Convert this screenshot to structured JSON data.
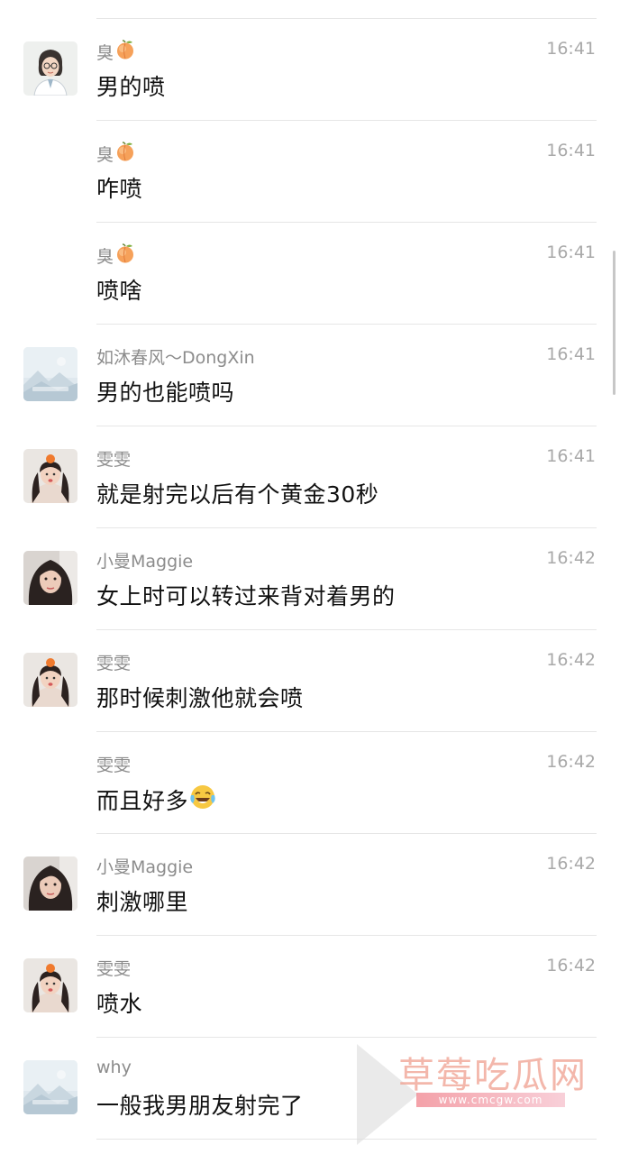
{
  "messages": [
    {
      "sender": "臭",
      "sender_emoji": "peach-emoji",
      "time": "16:41",
      "text": "男的喷",
      "avatar": "avatar-cartoon-woman-glasses"
    },
    {
      "sender": "臭",
      "sender_emoji": "peach-emoji",
      "time": "16:41",
      "text": "咋喷",
      "avatar": ""
    },
    {
      "sender": "臭",
      "sender_emoji": "peach-emoji",
      "time": "16:41",
      "text": "喷啥",
      "avatar": ""
    },
    {
      "sender": "如沐春风～DongXin",
      "time": "16:41",
      "text": "男的也能喷吗",
      "avatar": "avatar-landscape-placeholder"
    },
    {
      "sender": "雯雯",
      "time": "16:41",
      "text": "就是射完以后有个黄金30秒",
      "avatar": "avatar-girl-orange-hat"
    },
    {
      "sender": "小曼Maggie",
      "time": "16:42",
      "text": "女上时可以转过来背对着男的",
      "avatar": "avatar-woman-photo"
    },
    {
      "sender": "雯雯",
      "time": "16:42",
      "text": "那时候刺激他就会喷",
      "avatar": "avatar-girl-orange-hat"
    },
    {
      "sender": "雯雯",
      "time": "16:42",
      "text": "而且好多",
      "text_emoji": "laughing-crying-emoji",
      "avatar": ""
    },
    {
      "sender": "小曼Maggie",
      "time": "16:42",
      "text": "刺激哪里",
      "avatar": "avatar-woman-photo"
    },
    {
      "sender": "雯雯",
      "time": "16:42",
      "text": "喷水",
      "avatar": "avatar-girl-orange-hat"
    },
    {
      "sender": "why",
      "time": "",
      "text": "一般我男朋友射完了",
      "avatar": "avatar-landscape-placeholder"
    }
  ],
  "watermark": {
    "name": "草莓吃瓜网",
    "url": "www.cmcgw.com",
    "colors": {
      "name": "#f0a090",
      "band": "#f0828c"
    }
  },
  "colors": {
    "background": "#ffffff",
    "sender_text": "#8c8c8c",
    "time_text": "#a9a9a9",
    "message_text": "#111111",
    "divider": "#e6e6e6"
  }
}
